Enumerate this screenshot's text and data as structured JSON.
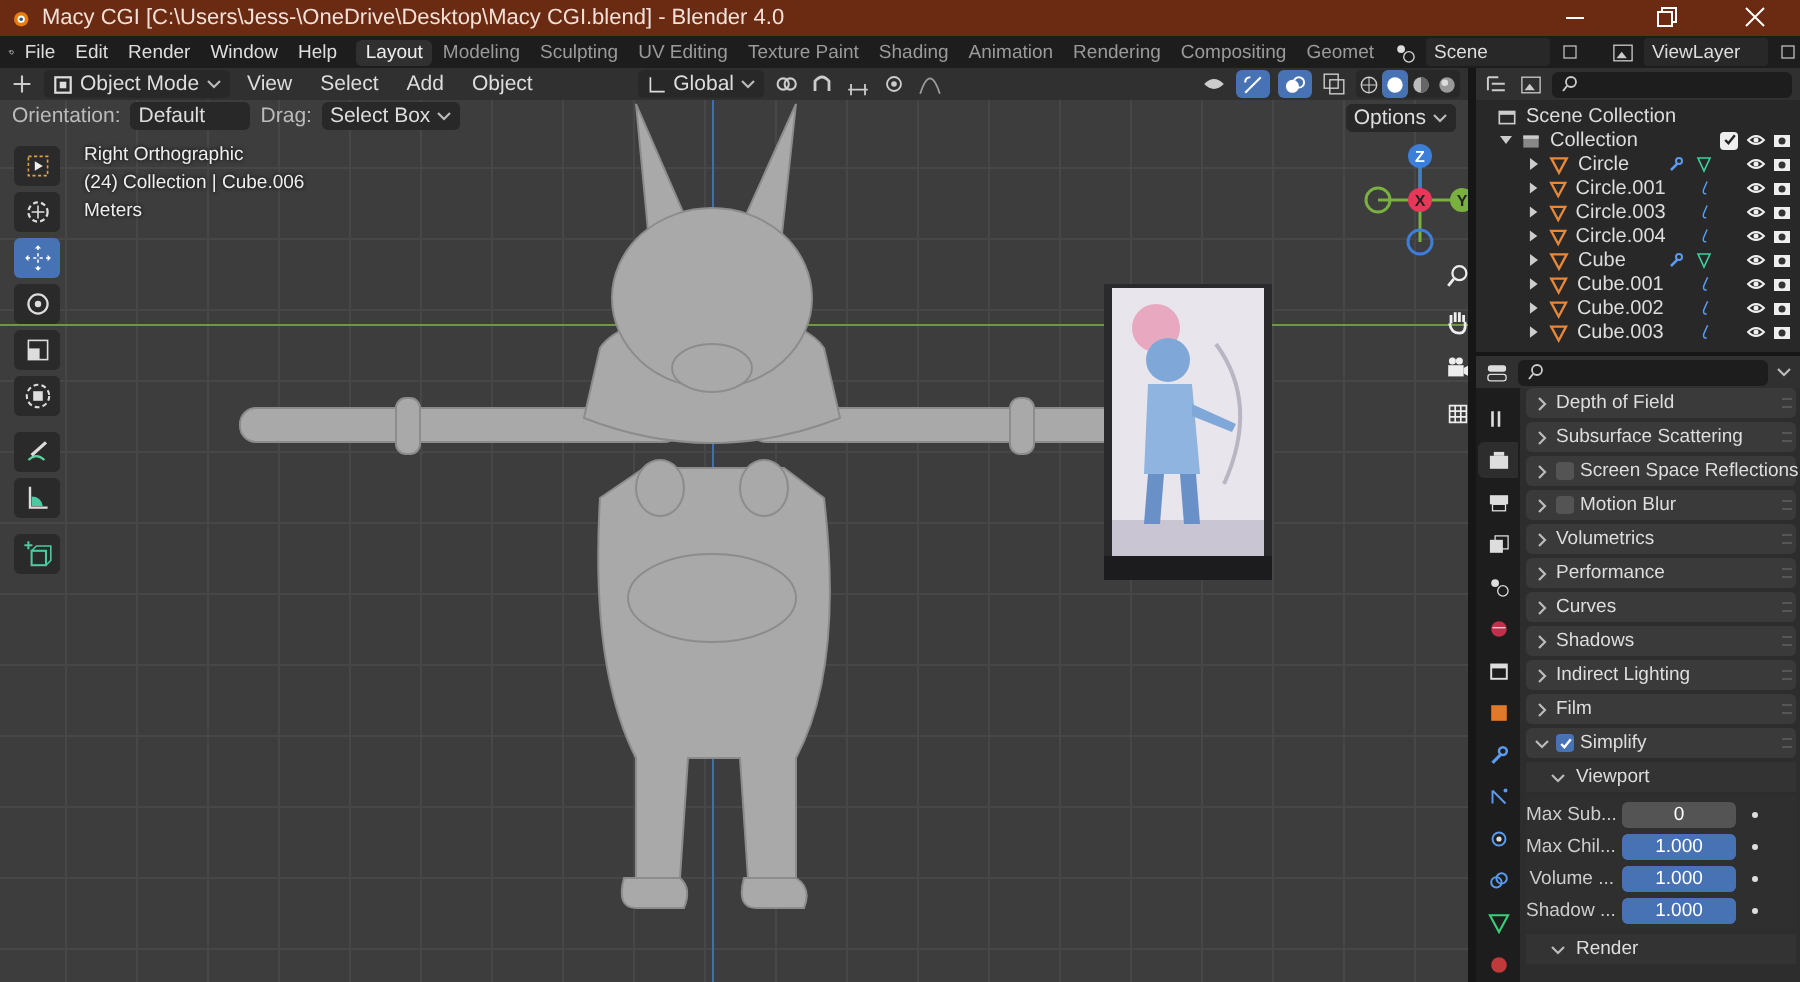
{
  "window": {
    "title": "Macy CGI [C:\\Users\\Jess-\\OneDrive\\Desktop\\Macy CGI.blend] - Blender 4.0"
  },
  "menu": [
    "File",
    "Edit",
    "Render",
    "Window",
    "Help"
  ],
  "workspaces": [
    {
      "label": "Layout",
      "selected": true
    },
    {
      "label": "Modeling",
      "selected": false
    },
    {
      "label": "Sculpting",
      "selected": false
    },
    {
      "label": "UV Editing",
      "selected": false
    },
    {
      "label": "Texture Paint",
      "selected": false
    },
    {
      "label": "Shading",
      "selected": false
    },
    {
      "label": "Animation",
      "selected": false
    },
    {
      "label": "Rendering",
      "selected": false
    },
    {
      "label": "Compositing",
      "selected": false
    },
    {
      "label": "Geomet",
      "selected": false
    }
  ],
  "scene": {
    "value": "Scene"
  },
  "view_layer": {
    "value": "ViewLayer"
  },
  "viewport": {
    "mode": "Object Mode",
    "menus": [
      "View",
      "Select",
      "Add",
      "Object"
    ],
    "orientation": "Global",
    "gizmo_on": true,
    "overlays_on": true,
    "shading_modes": [
      {
        "selected": false
      },
      {
        "selected": true
      },
      {
        "selected": false
      },
      {
        "selected": false
      }
    ],
    "tool_settings": {
      "orientation_label": "Orientation:",
      "orientation": "Default",
      "drag_label": "Drag:",
      "drag": "Select Box",
      "options": "Options"
    },
    "info": [
      "Right Orthographic",
      "(24) Collection | Cube.006",
      "Meters"
    ],
    "tools": [
      {
        "selected": false
      },
      {
        "selected": false
      },
      {
        "selected": true
      },
      {
        "selected": false
      },
      {
        "selected": false
      },
      {
        "selected": false
      },
      {
        "selected": false
      },
      {
        "selected": false
      },
      {
        "selected": false
      }
    ],
    "gizmo_axes": [
      "X",
      "Y",
      "Z"
    ]
  },
  "outliner": {
    "root": "Scene Collection",
    "collection": {
      "name": "Collection",
      "checked": true,
      "expanded": true,
      "children": [
        {
          "name": "Circle",
          "kind": "modified",
          "expanded": false
        },
        {
          "name": "Circle.001",
          "kind": "rigged",
          "expanded": false
        },
        {
          "name": "Circle.003",
          "kind": "rigged",
          "expanded": false
        },
        {
          "name": "Circle.004",
          "kind": "rigged",
          "expanded": false
        },
        {
          "name": "Cube",
          "kind": "modified",
          "expanded": false
        },
        {
          "name": "Cube.001",
          "kind": "rigged",
          "expanded": false
        },
        {
          "name": "Cube.002",
          "kind": "rigged",
          "expanded": false
        },
        {
          "name": "Cube.003",
          "kind": "rigged",
          "expanded": false
        }
      ]
    }
  },
  "properties": {
    "tabs": [
      {
        "selected": false
      },
      {
        "selected": true
      },
      {
        "selected": false
      },
      {
        "selected": false
      },
      {
        "selected": false
      },
      {
        "selected": false
      },
      {
        "selected": false
      },
      {
        "selected": false
      },
      {
        "selected": false
      },
      {
        "selected": false
      },
      {
        "selected": false
      },
      {
        "selected": false
      },
      {
        "selected": false
      },
      {
        "selected": false
      }
    ],
    "panels": [
      {
        "label": "Depth of Field",
        "kind": "plain",
        "expanded": false
      },
      {
        "label": "Subsurface Scattering",
        "kind": "plain",
        "expanded": false
      },
      {
        "label": "Screen Space Reflections",
        "kind": "checkbox",
        "checked": false,
        "expanded": false
      },
      {
        "label": "Motion Blur",
        "kind": "checkbox",
        "checked": false,
        "expanded": false
      },
      {
        "label": "Volumetrics",
        "kind": "plain",
        "expanded": false
      },
      {
        "label": "Performance",
        "kind": "plain",
        "expanded": false
      },
      {
        "label": "Curves",
        "kind": "plain",
        "expanded": false
      },
      {
        "label": "Shadows",
        "kind": "plain",
        "expanded": false
      },
      {
        "label": "Indirect Lighting",
        "kind": "plain",
        "expanded": false
      },
      {
        "label": "Film",
        "kind": "plain",
        "expanded": false
      },
      {
        "label": "Simplify",
        "kind": "checkbox",
        "checked": true,
        "expanded": true,
        "children": [
          {
            "label": "Viewport",
            "expanded": true,
            "fields": [
              {
                "label": "Max Sub...",
                "value": "0"
              },
              {
                "label": "Max Chil...",
                "value": "1.000",
                "level": 1
              },
              {
                "label": "Volume ...",
                "value": "1.000",
                "level": 1
              },
              {
                "label": "Shadow ...",
                "value": "1.000",
                "level": 1
              }
            ]
          },
          {
            "label": "Render",
            "expanded": true
          }
        ]
      }
    ]
  }
}
